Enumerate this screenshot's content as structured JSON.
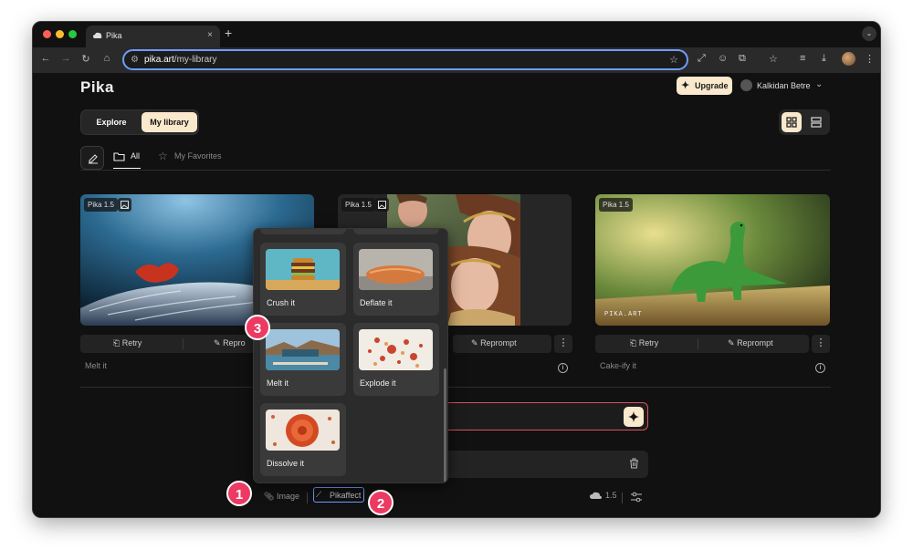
{
  "browser": {
    "tab_title": "Pika",
    "tab_close": "×",
    "new_tab": "+",
    "url_domain": "pika.art",
    "url_path": "/my-library"
  },
  "header": {
    "logo": "Pika",
    "upgrade_label": "Upgrade",
    "user_name": "Kalkidan Betre"
  },
  "nav": {
    "explore": "Explore",
    "my_library": "My library"
  },
  "filters": {
    "all": "All",
    "favorites": "My Favorites"
  },
  "cards": [
    {
      "badge": "Pika 1.5",
      "retry": "Retry",
      "reprompt": "Repro",
      "caption": "Melt it"
    },
    {
      "badge": "Pika 1.5",
      "reprompt": "Reprompt"
    },
    {
      "badge": "Pika 1.5",
      "retry": "Retry",
      "reprompt": "Reprompt",
      "caption": "Cake-ify it",
      "watermark": "PIKA.ART"
    }
  ],
  "pikaffects": [
    {
      "label": "Crush it"
    },
    {
      "label": "Deflate it"
    },
    {
      "label": "Melt it"
    },
    {
      "label": "Explode it"
    },
    {
      "label": "Dissolve it"
    }
  ],
  "bottom_bar": {
    "image_label": "Image",
    "pikaffect_label": "Pikaffect",
    "model_version": "1.5"
  },
  "callouts": [
    "1",
    "2",
    "3"
  ],
  "colors": {
    "accent": "#fbe9cd",
    "callout": "#ec3a63",
    "focus": "#6f9cff",
    "prompt_border": "#d9535f"
  }
}
